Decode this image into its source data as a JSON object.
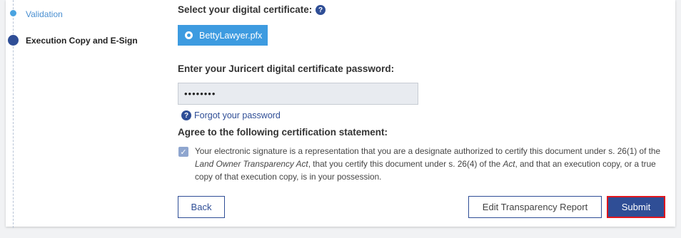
{
  "stepper": {
    "steps": [
      {
        "label": "Validation"
      },
      {
        "label": "Execution Copy and E-Sign"
      }
    ]
  },
  "certificate": {
    "select_label": "Select your digital certificate:",
    "help_glyph": "?",
    "option": "BettyLawyer.pfx"
  },
  "password": {
    "label": "Enter your Juricert digital certificate password:",
    "value": "••••••••",
    "forgot_link": "Forgot your password"
  },
  "agreement": {
    "label": "Agree to the following certification statement:",
    "checked": true,
    "check_glyph": "✓",
    "statement_parts": [
      "Your electronic signature is a representation that you are a designate authorized to certify this document under s. 26(1) of the ",
      "Land Owner Transparency Act",
      ", that you certify this document under s. 26(4) of the ",
      "Act",
      ", and that an execution copy, or a true copy of that execution copy, is in your possession."
    ]
  },
  "buttons": {
    "back": "Back",
    "edit": "Edit Transparency Report",
    "submit": "Submit"
  },
  "colors": {
    "primary": "#2f4e96",
    "accent": "#3d9be0",
    "submit_border": "#e0161e"
  }
}
